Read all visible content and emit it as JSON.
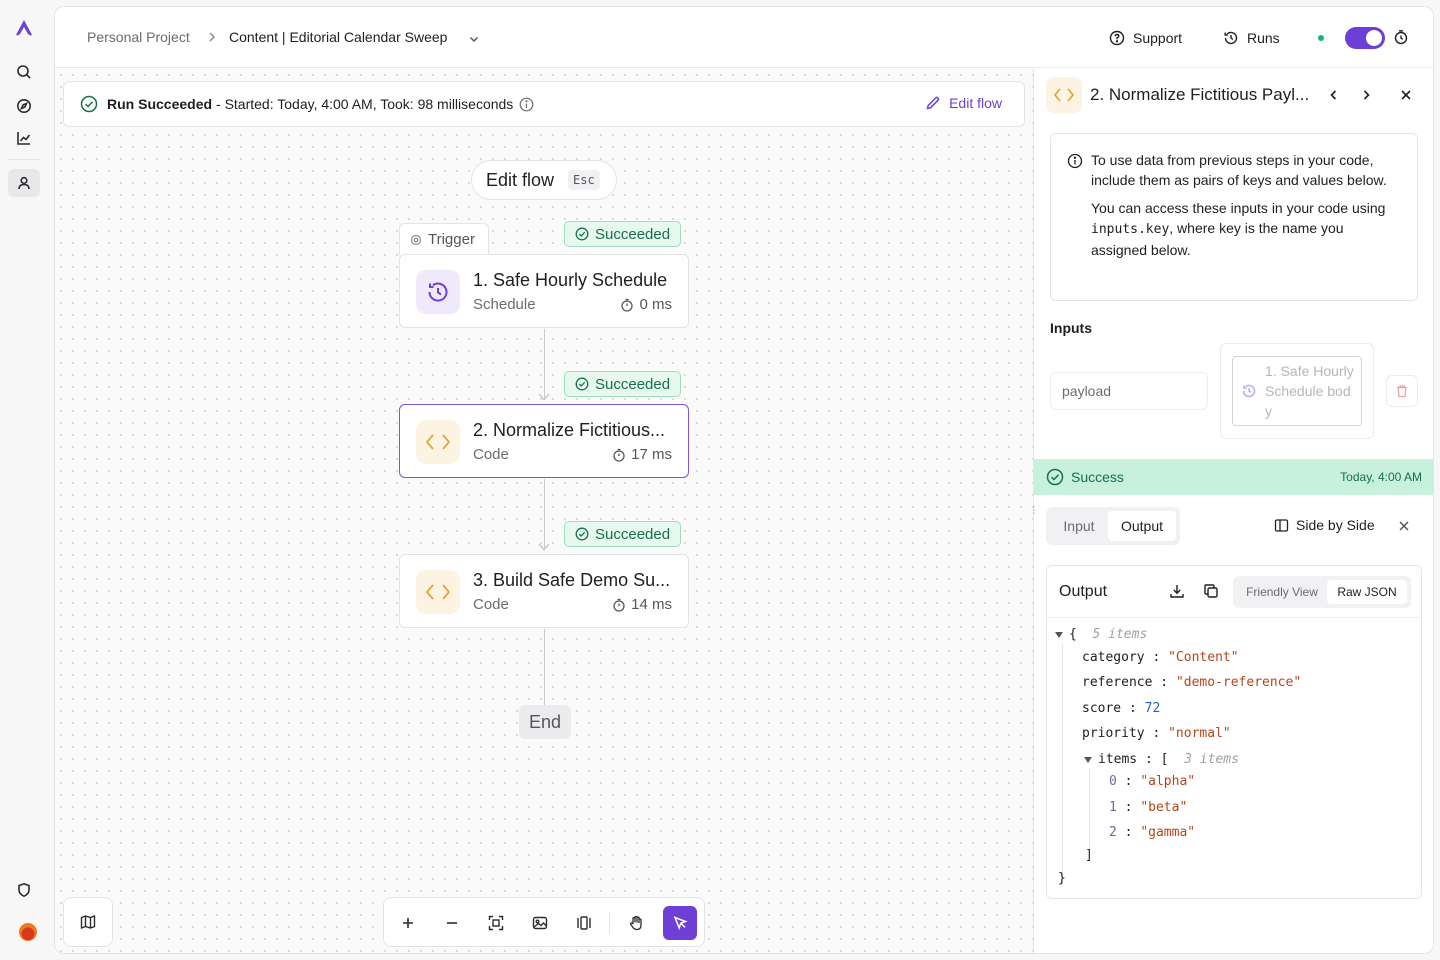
{
  "breadcrumb": {
    "project": "Personal Project",
    "separator": ">",
    "flow_name": "Content | Editorial Calendar Sweep"
  },
  "topbar": {
    "support_label": "Support",
    "runs_label": "Runs",
    "flow_enabled": true
  },
  "run_banner": {
    "status": "Run Succeeded",
    "detail": "- Started: Today, 4:00 AM, Took: 98 milliseconds",
    "edit_label": "Edit flow"
  },
  "canvas": {
    "edit_pill_label": "Edit flow",
    "edit_pill_key": "Esc",
    "trigger_tab": "Trigger",
    "end_label": "End",
    "steps": [
      {
        "title": "1. Safe Hourly Schedule",
        "type": "Schedule",
        "duration": "0 ms",
        "status": "Succeeded",
        "icon": "schedule-clock-icon"
      },
      {
        "title": "2. Normalize Fictitious...",
        "type": "Code",
        "duration": "17 ms",
        "status": "Succeeded",
        "icon": "code-brackets-icon",
        "selected": true
      },
      {
        "title": "3. Build Safe Demo Su...",
        "type": "Code",
        "duration": "14 ms",
        "status": "Succeeded",
        "icon": "code-brackets-icon"
      }
    ]
  },
  "panel": {
    "title": "2. Normalize Fictitious Payl...",
    "info_p1": "To use data from previous steps in your code, include them as pairs of keys and values below.",
    "info_p2_a": "You can access these inputs in your code using ",
    "info_p2_code": "inputs.key",
    "info_p2_b": ", where key is the name you assigned below.",
    "inputs_label": "Inputs",
    "input_key": "payload",
    "input_value": "1. Safe Hourly Schedule body",
    "result_status": "Success",
    "result_time": "Today, 4:00 AM",
    "tab_input": "Input",
    "tab_output": "Output",
    "side_by_side": "Side by Side",
    "output_title": "Output",
    "view_friendly": "Friendly View",
    "view_raw": "Raw JSON",
    "json": {
      "root_count": "5 items",
      "category_key": "category",
      "category_val": "\"Content\"",
      "reference_key": "reference",
      "reference_val": "\"demo-reference\"",
      "score_key": "score",
      "score_val": "72",
      "priority_key": "priority",
      "priority_val": "\"normal\"",
      "items_key": "items",
      "items_count": "3 items",
      "item0": "\"alpha\"",
      "item1": "\"beta\"",
      "item2": "\"gamma\""
    }
  },
  "colors": {
    "accent": "#6d3fd6",
    "success_bg": "#c8f1db",
    "success_text": "#17704a",
    "code_icon_bg": "#fdf3e3",
    "code_icon_fg": "#e2a53c"
  }
}
